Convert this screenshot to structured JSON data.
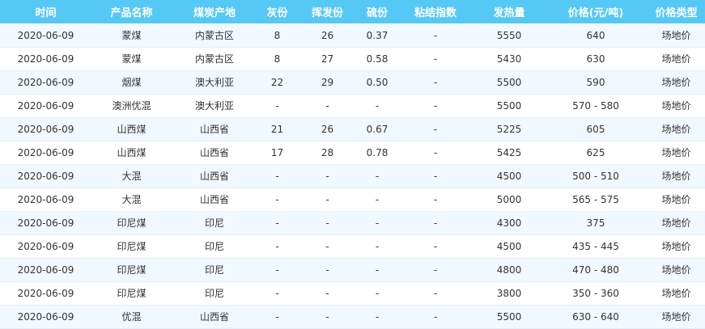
{
  "table": {
    "headers": [
      "时间",
      "产品名称",
      "煤炭产地",
      "灰份",
      "挥发份",
      "硫份",
      "粘结指数",
      "发热量",
      "价格(元/吨)",
      "价格类型"
    ],
    "rows": [
      [
        "2020-06-09",
        "蒙煤",
        "内蒙古区",
        "8",
        "26",
        "0.37",
        "-",
        "5550",
        "640",
        "场地价"
      ],
      [
        "2020-06-09",
        "蒙煤",
        "内蒙古区",
        "8",
        "27",
        "0.58",
        "-",
        "5430",
        "630",
        "场地价"
      ],
      [
        "2020-06-09",
        "烟煤",
        "澳大利亚",
        "22",
        "29",
        "0.50",
        "-",
        "5500",
        "590",
        "场地价"
      ],
      [
        "2020-06-09",
        "澳洲优混",
        "澳大利亚",
        "-",
        "-",
        "-",
        "-",
        "5500",
        "570 - 580",
        "场地价"
      ],
      [
        "2020-06-09",
        "山西煤",
        "山西省",
        "21",
        "26",
        "0.67",
        "-",
        "5225",
        "605",
        "场地价"
      ],
      [
        "2020-06-09",
        "山西煤",
        "山西省",
        "17",
        "28",
        "0.78",
        "-",
        "5425",
        "625",
        "场地价"
      ],
      [
        "2020-06-09",
        "大混",
        "山西省",
        "-",
        "-",
        "-",
        "-",
        "4500",
        "500 - 510",
        "场地价"
      ],
      [
        "2020-06-09",
        "大混",
        "山西省",
        "-",
        "-",
        "-",
        "-",
        "5000",
        "565 - 575",
        "场地价"
      ],
      [
        "2020-06-09",
        "印尼煤",
        "印尼",
        "-",
        "-",
        "-",
        "-",
        "4300",
        "375",
        "场地价"
      ],
      [
        "2020-06-09",
        "印尼煤",
        "印尼",
        "-",
        "-",
        "-",
        "-",
        "4500",
        "435 - 445",
        "场地价"
      ],
      [
        "2020-06-09",
        "印尼煤",
        "印尼",
        "-",
        "-",
        "-",
        "-",
        "4800",
        "470 - 480",
        "场地价"
      ],
      [
        "2020-06-09",
        "印尼煤",
        "印尼",
        "-",
        "-",
        "-",
        "-",
        "3800",
        "350 - 360",
        "场地价"
      ],
      [
        "2020-06-09",
        "优混",
        "山西省",
        "-",
        "-",
        "-",
        "-",
        "5500",
        "630 - 640",
        "场地价"
      ]
    ]
  },
  "colors": {
    "header_bg": "#56c8f6",
    "header_text": "#ffffff",
    "row_alt_bg": "#f0f9ff",
    "row_bg": "#ffffff",
    "cell_text": "#333333"
  }
}
